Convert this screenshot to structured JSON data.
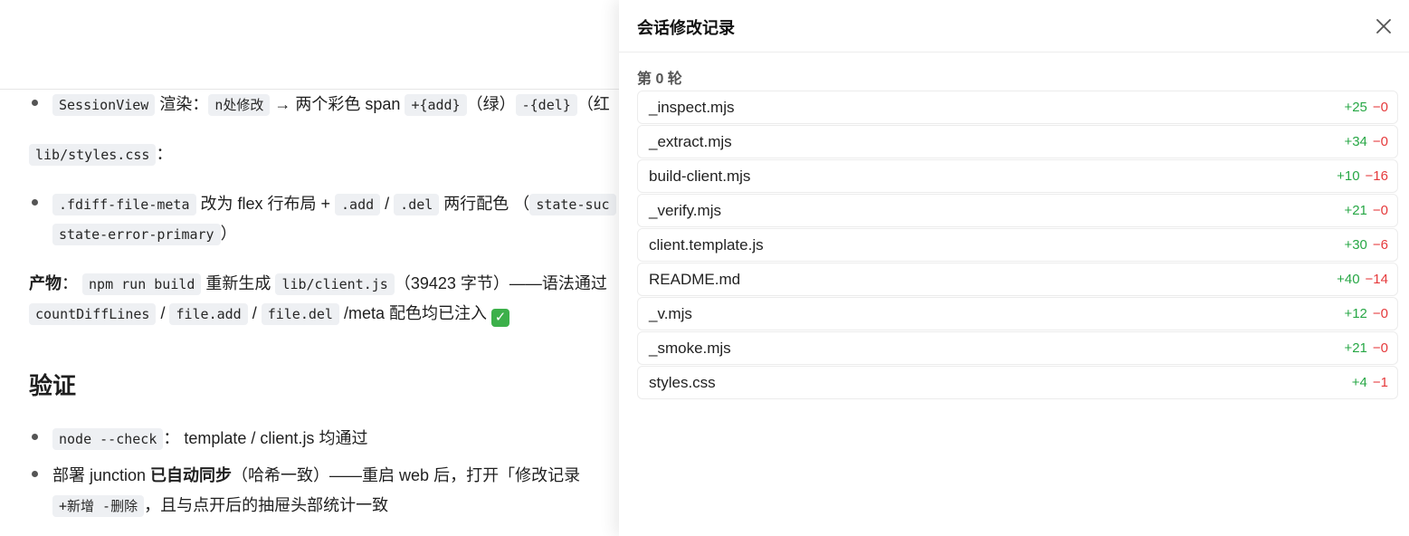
{
  "doc": {
    "b1": {
      "code1": "SessionView",
      "t1": " 渲染：",
      "code2": "n处修改",
      "t2": " → 两个彩色 span ",
      "code3": "+{add}",
      "t3": "（绿）",
      "code4": "-{del}",
      "t4": "（红"
    },
    "line2": {
      "code": "lib/styles.css",
      "t": "："
    },
    "b2": {
      "code1": ".fdiff-file-meta",
      "t1": " 改为 flex 行布局 + ",
      "code2": ".add",
      "t2": " / ",
      "code3": ".del",
      "t3": " 两行配色 （",
      "code4": "state-suc"
    },
    "b2b": {
      "code": "state-error-primary",
      "t": "）"
    },
    "p1": {
      "label": "产物",
      "t0": "：",
      "code1": "npm run build",
      "t1": " 重新生成 ",
      "code2": "lib/client.js",
      "t2": "（39423 字节）——语法通过"
    },
    "p1b": {
      "code1": "countDiffLines",
      "sep1": " / ",
      "code2": "file.add",
      "sep2": " / ",
      "code3": "file.del",
      "t": " /meta 配色均已注入 "
    },
    "heading": "验证",
    "b3": {
      "code": "node --check",
      "t": "： template / client.js 均通过"
    },
    "b4": {
      "t1": "部署 junction ",
      "bold": "已自动同步",
      "t2": "（哈希一致）——重启 web 后，打开「修改记录"
    },
    "b4b": {
      "code": "+新增 -删除",
      "t": "，且与点开后的抽屉头部统计一致"
    }
  },
  "drawer": {
    "title": "会话修改记录",
    "round_label": "第 0 轮",
    "files": [
      {
        "name": "_inspect.mjs",
        "add": "+25",
        "del": "−0"
      },
      {
        "name": "_extract.mjs",
        "add": "+34",
        "del": "−0"
      },
      {
        "name": "build-client.mjs",
        "add": "+10",
        "del": "−16"
      },
      {
        "name": "_verify.mjs",
        "add": "+21",
        "del": "−0"
      },
      {
        "name": "client.template.js",
        "add": "+30",
        "del": "−6"
      },
      {
        "name": "README.md",
        "add": "+40",
        "del": "−14"
      },
      {
        "name": "_v.mjs",
        "add": "+12",
        "del": "−0"
      },
      {
        "name": "_smoke.mjs",
        "add": "+21",
        "del": "−0"
      },
      {
        "name": "styles.css",
        "add": "+4",
        "del": "−1"
      }
    ]
  },
  "colors": {
    "add": "#27a745",
    "del": "#e5393b",
    "code_bg": "#eef0f3"
  }
}
